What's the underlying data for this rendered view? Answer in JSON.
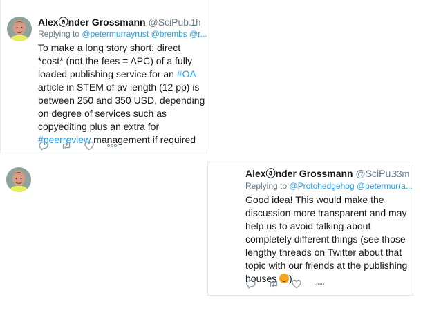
{
  "tweets": [
    {
      "author_name": "Alexⓐnder Grossmann",
      "author_handle": "@SciPub...",
      "time": "1h",
      "reply_prefix": "Replying to",
      "reply_to": "@petermurrayrust @brembs @r...",
      "lines": [
        [
          {
            "text": "To make a long story short: direct"
          }
        ],
        [
          {
            "text": "*cost* (not the fees = APC) of a fully"
          }
        ],
        [
          {
            "text": "loaded publishing service for an "
          },
          {
            "text": "#OA",
            "tag": true
          }
        ],
        [
          {
            "text": "article in STEM of av length (12 pp) is"
          }
        ],
        [
          {
            "text": "between 250 and 350 USD, depending"
          }
        ],
        [
          {
            "text": "on degree of services such as"
          }
        ],
        [
          {
            "text": "copyediting plus an extra for"
          }
        ],
        [
          {
            "text": "#peerreview",
            "tag": true
          },
          {
            "text": " management if required"
          }
        ]
      ],
      "actions": [
        "reply-icon",
        "retweet-icon",
        "like-icon",
        "more-icon"
      ]
    },
    {
      "author_name": "Alexⓐnder Grossmann",
      "author_handle": "@SciPu...",
      "time": "33m",
      "reply_prefix": "Replying to",
      "reply_to": "@Protohedgehog @petermurra...",
      "lines": [
        [
          {
            "text": "Good idea! This would make the"
          }
        ],
        [
          {
            "text": "discussion more transparent and may"
          }
        ],
        [
          {
            "text": "help us to avoid talking about"
          }
        ],
        [
          {
            "text": "completely different things (see those"
          }
        ],
        [
          {
            "text": "lengthy threads on Twitter about that"
          }
        ],
        [
          {
            "text": "topic with our friends at the publishing"
          }
        ],
        [
          {
            "text": "houses "
          },
          {
            "emoji": "smiling-face-emoji"
          },
          {
            "text": ")"
          }
        ]
      ],
      "actions": [
        "reply-icon",
        "retweet-icon",
        "like-icon",
        "more-icon"
      ]
    }
  ],
  "colors": {
    "link": "#1da1f2",
    "meta": "#657786",
    "text": "#14171a",
    "border": "#e1e8ed",
    "emoji": "#f5a623"
  }
}
